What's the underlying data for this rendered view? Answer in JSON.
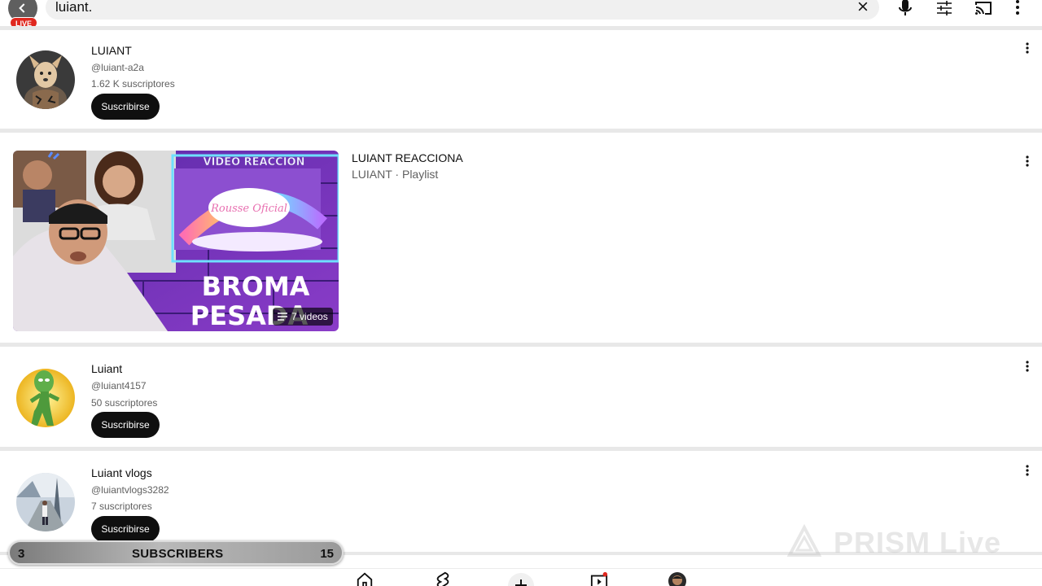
{
  "search": {
    "query": "luiant.",
    "live_badge": "LIVE"
  },
  "channels": [
    {
      "name": "LUIANT",
      "handle": "@luiant-a2a",
      "subs": "1.62 K suscriptores",
      "subscribe_label": "Suscribirse"
    },
    {
      "name": "Luiant",
      "handle": "@luiant4157",
      "subs": "50 suscriptores",
      "subscribe_label": "Suscribirse"
    },
    {
      "name": "Luiant vlogs",
      "handle": "@luiantvlogs3282",
      "subs": "7 suscriptores",
      "subscribe_label": "Suscribirse"
    }
  ],
  "playlist": {
    "title": "LUIANT REACCIONA",
    "meta": "LUIANT · Playlist",
    "video_count": "7 videos",
    "thumb_banner": "VIDEO REACCION",
    "thumb_screen": "Rousse Oficial",
    "thumb_line1": "BROMA",
    "thumb_line2": "PESADA"
  },
  "sub_counter": {
    "left": "3",
    "label": "SUBSCRIBERS",
    "right": "15"
  },
  "watermark": "PRISM Live",
  "colors": {
    "subscribe_bg": "#0f0f0f",
    "live_red": "#e0281f",
    "divider": "#e8e8e8"
  },
  "icons": [
    "back-icon",
    "close-icon",
    "mic-icon",
    "filter-icon",
    "cast-icon",
    "more-vert-icon",
    "home-icon",
    "shorts-icon",
    "create-icon",
    "subscriptions-icon",
    "profile-avatar"
  ]
}
